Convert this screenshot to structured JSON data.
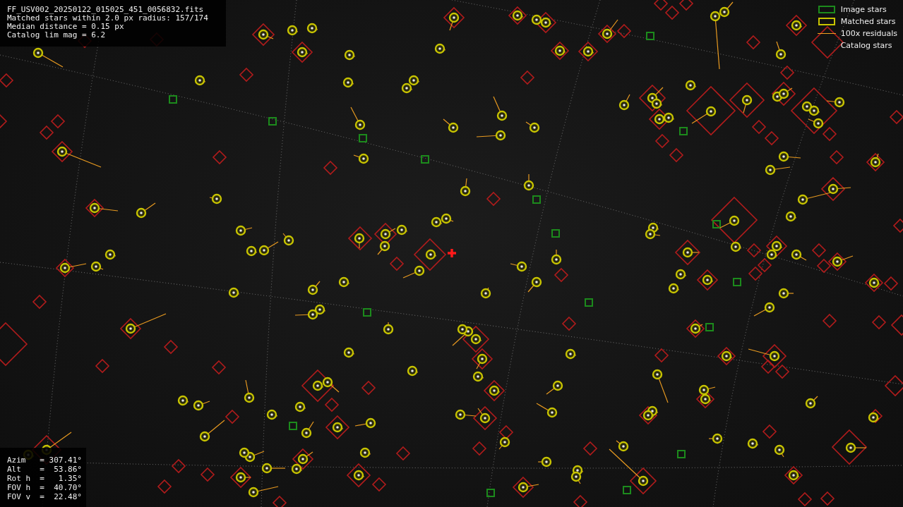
{
  "header": {
    "lines": [
      "FF_USV002_20250122_015025_451_0056832.fits",
      "Matched stars within 2.0 px radius: 157/174",
      "Median distance = 0.15 px",
      "Catalog lim mag = 6.2"
    ]
  },
  "legend": [
    {
      "kind": "image",
      "label": "Image stars"
    },
    {
      "kind": "matched",
      "label": "Matched stars"
    },
    {
      "kind": "residual",
      "label": "100x residuals"
    },
    {
      "kind": "catalog",
      "label": "Catalog stars"
    }
  ],
  "pointing": {
    "lines": [
      "Azim   = 307.41°",
      "Alt    =  53.86°",
      "Rot h  =   1.35°",
      "FOV h  =  40.70°",
      "FOV v  =  22.48°"
    ]
  }
}
